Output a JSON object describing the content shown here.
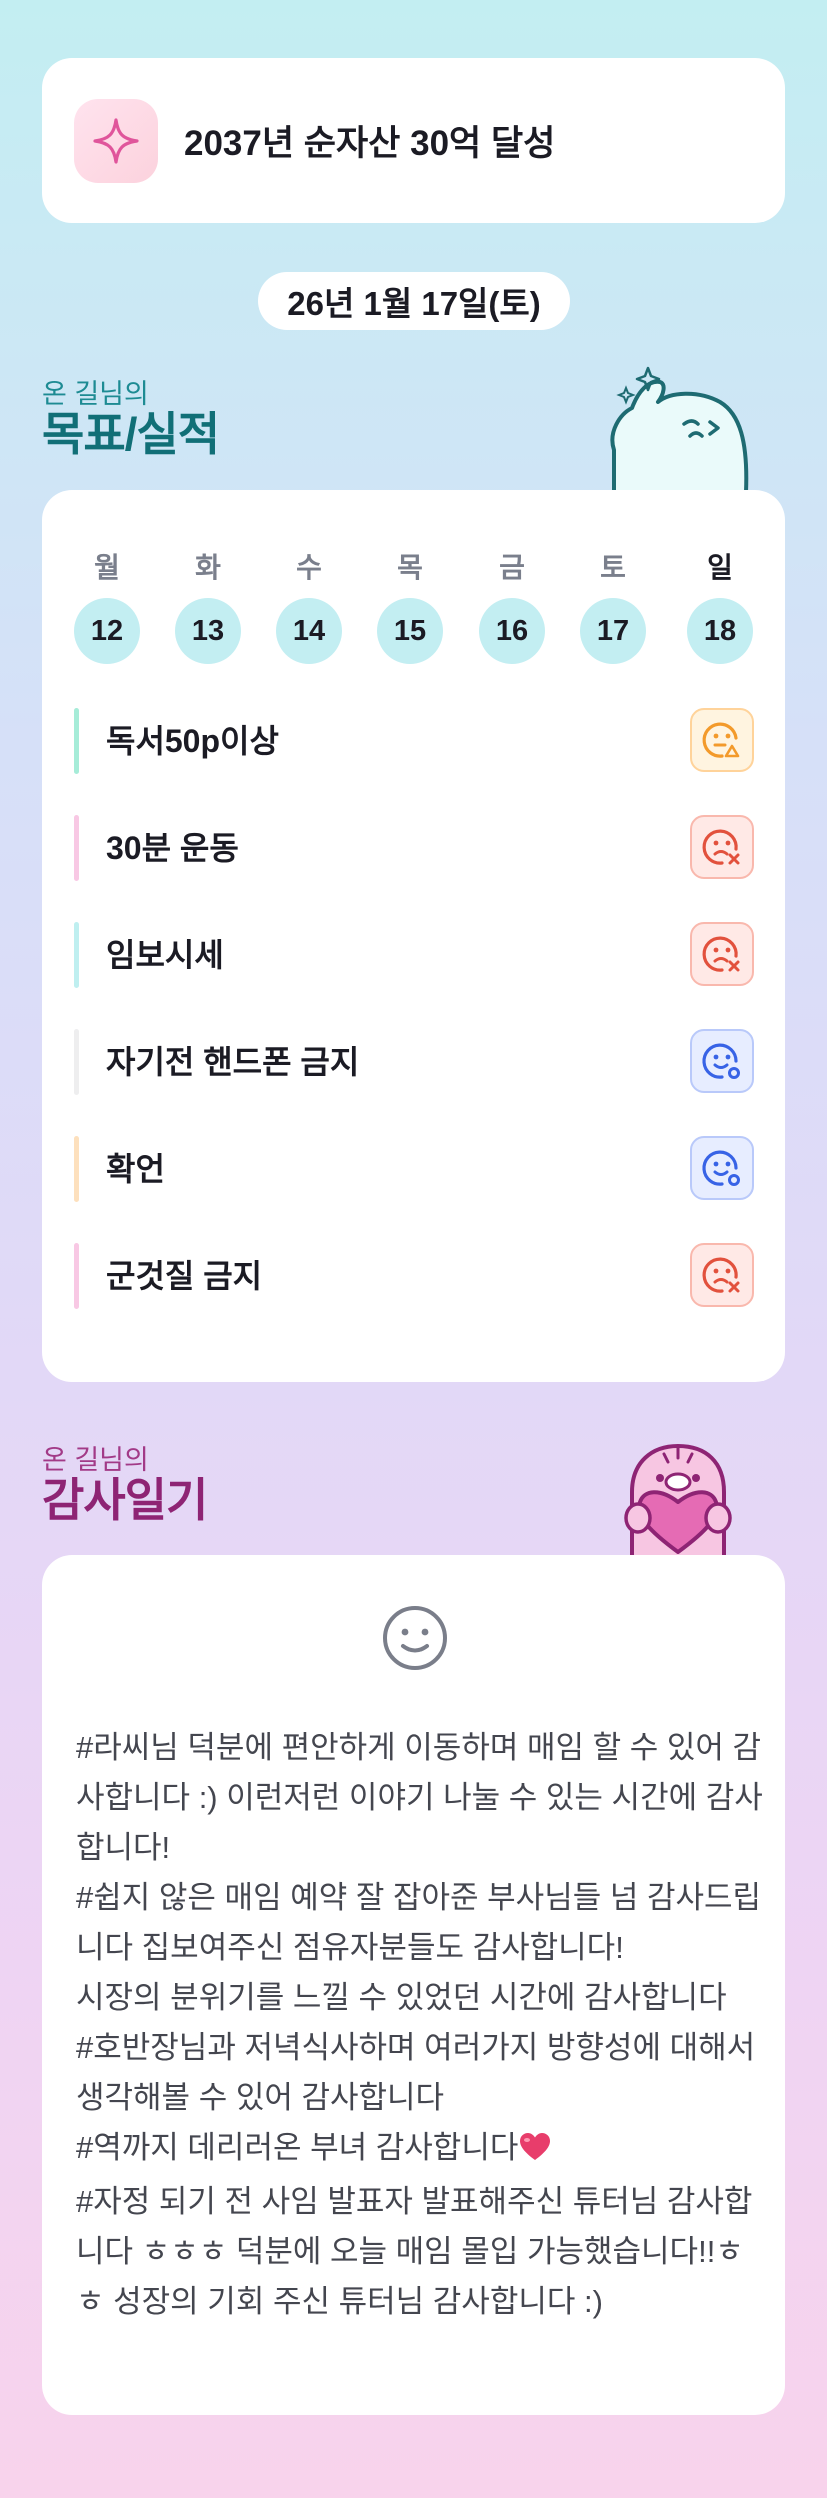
{
  "goal": {
    "title": "2037년 순자산 30억 달성",
    "icon": "sparkle-star-icon"
  },
  "date": "26년 1월 17일(토)",
  "goals_section": {
    "caption": "온 길님의",
    "title": "목표/실적"
  },
  "week": {
    "days": [
      {
        "name": "월",
        "date": "12"
      },
      {
        "name": "화",
        "date": "13"
      },
      {
        "name": "수",
        "date": "14"
      },
      {
        "name": "목",
        "date": "15"
      },
      {
        "name": "금",
        "date": "16"
      },
      {
        "name": "토",
        "date": "17"
      },
      {
        "name": "일",
        "date": "18"
      }
    ]
  },
  "tasks": [
    {
      "label": "독서50p이상",
      "status": "partial",
      "bar_color": "#a6ecd8"
    },
    {
      "label": "30분 운동",
      "status": "fail",
      "bar_color": "#f8c8e4"
    },
    {
      "label": "임보시세",
      "status": "fail",
      "bar_color": "#bfeff0"
    },
    {
      "label": "자기전 핸드폰 금지",
      "status": "done",
      "bar_color": "#eeeeef"
    },
    {
      "label": "확언",
      "status": "done",
      "bar_color": "#fde0bd"
    },
    {
      "label": "군것질 금지",
      "status": "fail",
      "bar_color": "#f8c8e4"
    }
  ],
  "gratitude_section": {
    "caption": "온 길님의",
    "title": "감사일기"
  },
  "gratitude": {
    "icon": "smiley-face-icon",
    "text": "#라씨님 덕분에 편안하게 이동하며 매임 할 수 있어 감사합니다 :) 이런저런 이야기 나눌 수 있는 시간에 감사합니다!\n#쉽지 않은 매임 예약 잘 잡아준 부사님들 넘 감사드립니다 집보여주신 점유자분들도 감사합니다!\n시장의 분위기를 느낄 수 있었던 시간에 감사합니다\n#호반장님과 저녁식사하며 여러가지 방향성에 대해서 생각해볼 수 있어 감사합니다\n#역까지 데리러온 부녀 감사합니다",
    "heart_icon": "heart-icon",
    "text_after": "\n#자정 되기 전 사임 발표자 발표해주신 튜터님 감사합니다 ㅎㅎㅎ 덕분에 오늘 매임 몰입 가능했습니다!!ㅎㅎ 성장의 기회 주신 튜터님 감사합니다 :)"
  }
}
